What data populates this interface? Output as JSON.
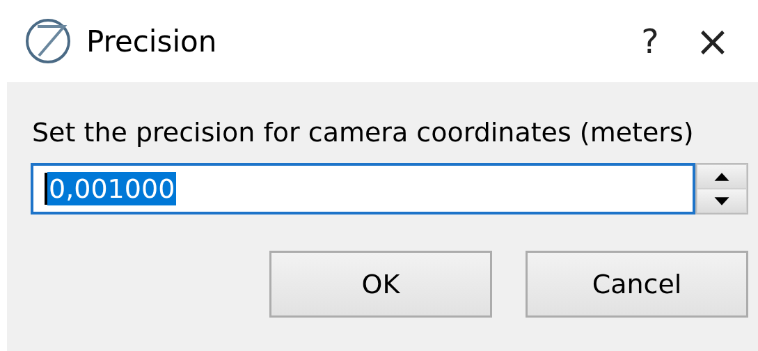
{
  "window": {
    "title": "Precision",
    "help": "?",
    "close": "×"
  },
  "prompt": "Set the precision for camera coordinates (meters)",
  "spinbox": {
    "value": "0,001000",
    "focused": true,
    "text_selected": true
  },
  "buttons": [
    {
      "label": "OK",
      "default": false
    },
    {
      "label": "Cancel",
      "default": false
    }
  ]
}
